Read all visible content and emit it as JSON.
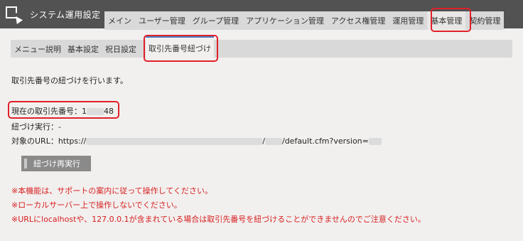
{
  "header": {
    "app_title": "システム運用設定",
    "tabs": [
      "メイン",
      "ユーザー管理",
      "グループ管理",
      "アプリケーション管理",
      "アクセス権管理",
      "運用管理",
      "基本管理",
      "契約管理"
    ],
    "active_tab": "基本管理"
  },
  "subnav": {
    "items": [
      "メニュー説明",
      "基本設定",
      "祝日設定"
    ],
    "active": "取引先番号紐づけ"
  },
  "content": {
    "description": "取引先番号の紐づけを行います。",
    "current_label": "現在の取引先番号：",
    "current_prefix": "1",
    "current_suffix": "48",
    "link_status": "紐づけ実行：-",
    "url_label": "対象のURL：https://",
    "url_mid": "/",
    "url_suffix": "/default.cfm?version="
  },
  "button": {
    "relink_label": "紐づけ再実行"
  },
  "warnings": [
    "※本機能は、サポートの案内に従って操作してください。",
    "※ローカルサーバー上で操作しないでください。",
    "※URLにlocalhostや、127.0.0.1が含まれている場合は取引先番号を紐づけることができませんのでご注意ください。"
  ]
}
